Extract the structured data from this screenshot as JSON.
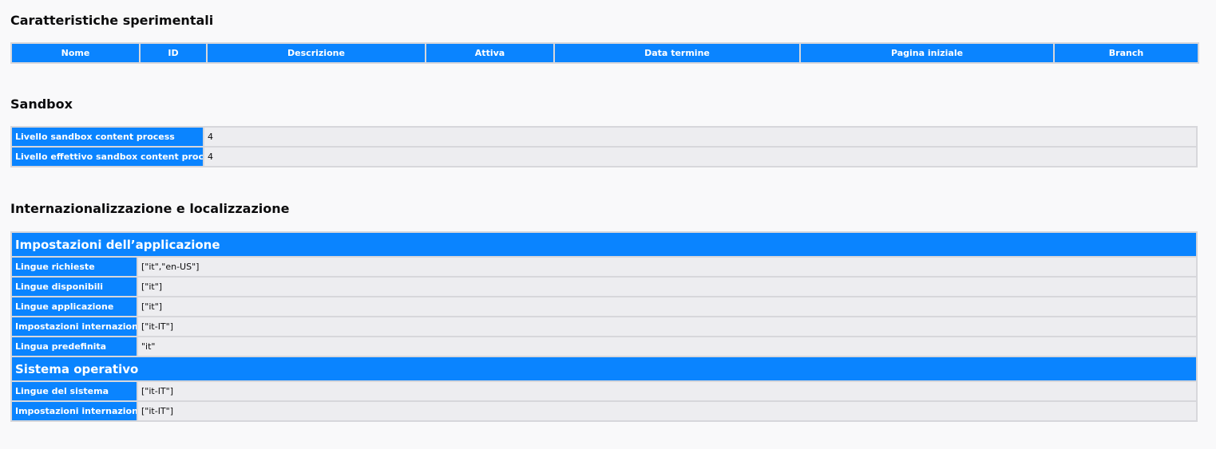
{
  "experimental": {
    "heading": "Caratteristiche sperimentali",
    "columns": [
      "Nome",
      "ID",
      "Descrizione",
      "Attiva",
      "Data termine",
      "Pagina iniziale",
      "Branch"
    ]
  },
  "sandbox": {
    "heading": "Sandbox",
    "rows": [
      {
        "key": "Livello sandbox content process",
        "value": "4"
      },
      {
        "key": "Livello effettivo sandbox content process",
        "value": "4"
      }
    ]
  },
  "intl": {
    "heading": "Internazionalizzazione e localizzazione",
    "app_section": "Impostazioni dell’applicazione",
    "app_rows": [
      {
        "key": "Lingue richieste",
        "value": "[\"it\",\"en-US\"]"
      },
      {
        "key": "Lingue disponibili",
        "value": "[\"it\"]"
      },
      {
        "key": "Lingue applicazione",
        "value": "[\"it\"]"
      },
      {
        "key": "Impostazioni internazionali",
        "value": "[\"it-IT\"]"
      },
      {
        "key": "Lingua predefinita",
        "value": "\"it\""
      }
    ],
    "os_section": "Sistema operativo",
    "os_rows": [
      {
        "key": "Lingue del sistema",
        "value": "[\"it-IT\"]"
      },
      {
        "key": "Impostazioni internazionali",
        "value": "[\"it-IT\"]"
      }
    ]
  }
}
